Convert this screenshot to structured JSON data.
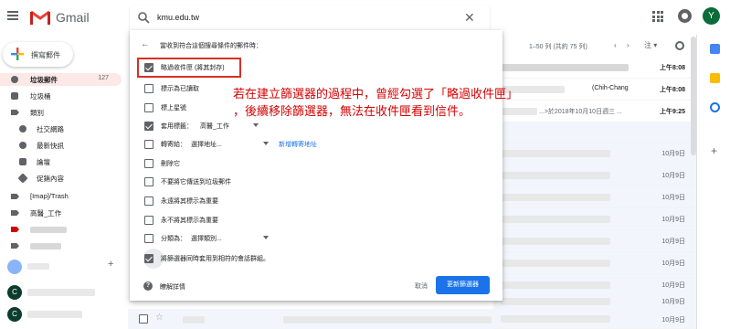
{
  "app": {
    "name": "Gmail"
  },
  "search": {
    "query": "kmu.edu.tw"
  },
  "user": {
    "avatar_letter": "Y"
  },
  "sidebar": {
    "compose_label": "撰寫郵件",
    "items": [
      {
        "label": "垃圾郵件",
        "count": "127"
      },
      {
        "label": "垃圾桶"
      },
      {
        "label": "類別"
      },
      {
        "label": "社交網路"
      },
      {
        "label": "最新快訊"
      },
      {
        "label": "論壇"
      },
      {
        "label": "促銷內容"
      },
      {
        "label": "[Imap]/Trash"
      },
      {
        "label": "高醫_工作"
      }
    ],
    "hangouts": [
      {
        "avatar_letter": "C"
      },
      {
        "avatar_letter": "C"
      }
    ]
  },
  "list_header": {
    "count_text": "1–50 列 (共約 75 列)",
    "prev": "‹",
    "next": "›",
    "language": "注",
    "language_caret": "▾"
  },
  "mail_rows": [
    {
      "snippet": "",
      "date": "上午8:08"
    },
    {
      "snippet": "",
      "date": "上午8:08"
    },
    {
      "snippet": "...>於2018年10月10日週三 ...",
      "date": "上午9:25"
    },
    {
      "snippet": "",
      "date": "10月9日"
    },
    {
      "snippet": "",
      "date": "10月9日"
    },
    {
      "snippet": "",
      "date": "10月9日"
    },
    {
      "snippet": "",
      "date": "10月9日"
    },
    {
      "snippet": "",
      "date": "10月9日"
    },
    {
      "snippet": "",
      "date": "10月9日"
    },
    {
      "snippet": "",
      "date": "10月9日"
    },
    {
      "snippet": "",
      "date": "10月9日"
    },
    {
      "snippet": "",
      "date": "10月9日"
    }
  ],
  "filter_panel": {
    "title": "當收到符合這個搜尋條件的郵件時：",
    "options": [
      {
        "label": "略過收件匣 (將其封存)",
        "checked": true
      },
      {
        "label": "標示為已讀取",
        "checked": false
      },
      {
        "label": "標上星號",
        "checked": false
      },
      {
        "label": "套用標籤：",
        "checked": true,
        "select": "高醫_工作"
      },
      {
        "label": "轉寄給：",
        "checked": false,
        "select": "選擇地址...",
        "link": "新增轉寄地址"
      },
      {
        "label": "刪除它",
        "checked": false
      },
      {
        "label": "不要將它傳送到垃圾郵件",
        "checked": false
      },
      {
        "label": "永遠將其標示為重要",
        "checked": false
      },
      {
        "label": "永不將其標示為重要",
        "checked": false
      },
      {
        "label": "分類為：",
        "checked": false,
        "select": "選擇類別..."
      },
      {
        "label": "將篩選器同時套用到相符的會話群組。",
        "checked": true
      }
    ],
    "help_label": "瞭解詳情",
    "cancel_label": "取消",
    "create_label": "更新篩選器"
  },
  "annotation": {
    "line1": "若在建立篩選器的過程中，曾經勾選了「略過收件匣」",
    "line2": "，後續移除篩選器，無法在收件匣看到信件。"
  },
  "snippet_name": "(Chih-Chang",
  "colors": {
    "accent": "#1a73e8",
    "annotation": "#d50000",
    "highlight": "#d93025"
  }
}
